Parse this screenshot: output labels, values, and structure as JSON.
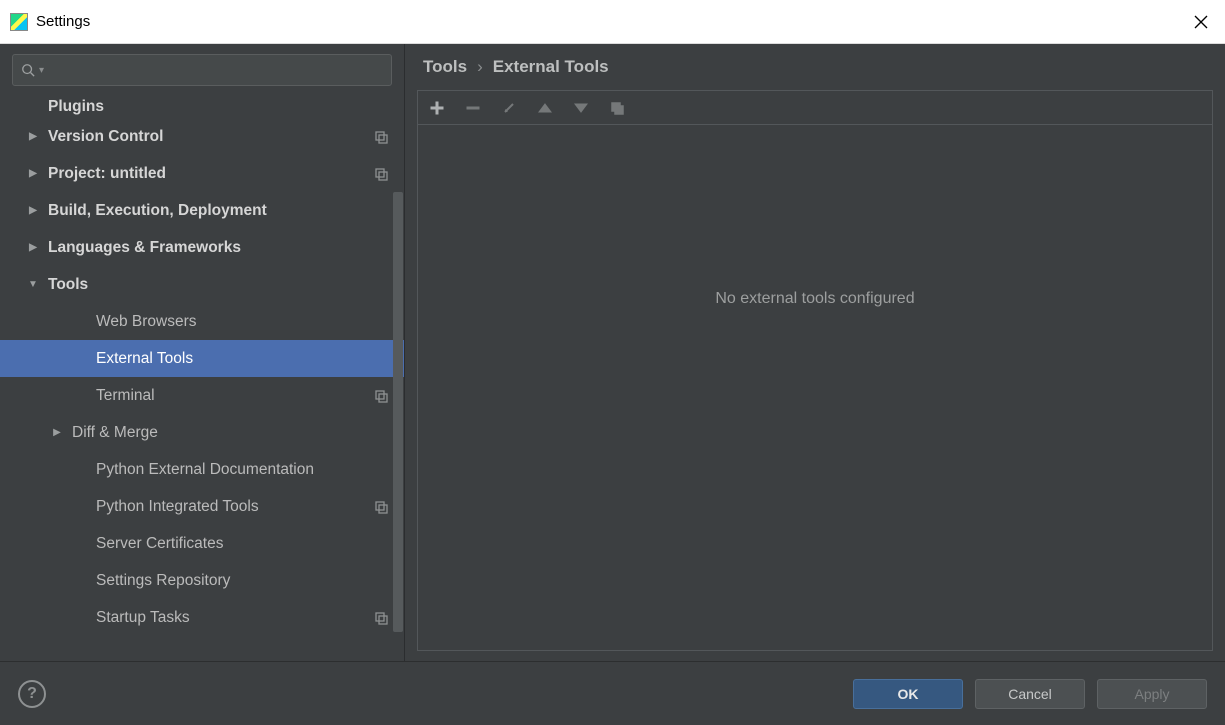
{
  "window": {
    "title": "Settings"
  },
  "search": {
    "placeholder": ""
  },
  "sidebar": {
    "items": [
      {
        "label": "Plugins",
        "bold": true,
        "cut": true,
        "indent": 0,
        "arrow": "",
        "proj": false
      },
      {
        "label": "Version Control",
        "bold": true,
        "indent": 0,
        "arrow": "right",
        "proj": true
      },
      {
        "label": "Project: untitled",
        "bold": true,
        "indent": 0,
        "arrow": "right",
        "proj": true
      },
      {
        "label": "Build, Execution, Deployment",
        "bold": true,
        "indent": 0,
        "arrow": "right",
        "proj": false
      },
      {
        "label": "Languages & Frameworks",
        "bold": true,
        "indent": 0,
        "arrow": "right",
        "proj": false
      },
      {
        "label": "Tools",
        "bold": true,
        "indent": 0,
        "arrow": "down",
        "proj": false
      },
      {
        "label": "Web Browsers",
        "indent": 2,
        "arrow": "",
        "proj": false
      },
      {
        "label": "External Tools",
        "indent": 2,
        "arrow": "",
        "proj": false,
        "selected": true
      },
      {
        "label": "Terminal",
        "indent": 2,
        "arrow": "",
        "proj": true
      },
      {
        "label": "Diff & Merge",
        "indent": 2,
        "arrow": "right",
        "arrowIndent": true,
        "proj": false
      },
      {
        "label": "Python External Documentation",
        "indent": 2,
        "arrow": "",
        "proj": false
      },
      {
        "label": "Python Integrated Tools",
        "indent": 2,
        "arrow": "",
        "proj": true
      },
      {
        "label": "Server Certificates",
        "indent": 2,
        "arrow": "",
        "proj": false
      },
      {
        "label": "Settings Repository",
        "indent": 2,
        "arrow": "",
        "proj": false
      },
      {
        "label": "Startup Tasks",
        "indent": 2,
        "arrow": "",
        "proj": true
      }
    ]
  },
  "breadcrumb": {
    "root": "Tools",
    "leaf": "External Tools"
  },
  "toolbar": {
    "add": "add",
    "remove": "remove",
    "edit": "edit",
    "up": "up",
    "down": "down",
    "copy": "copy"
  },
  "panel": {
    "empty_text": "No external tools configured"
  },
  "footer": {
    "ok": "OK",
    "cancel": "Cancel",
    "apply": "Apply"
  }
}
